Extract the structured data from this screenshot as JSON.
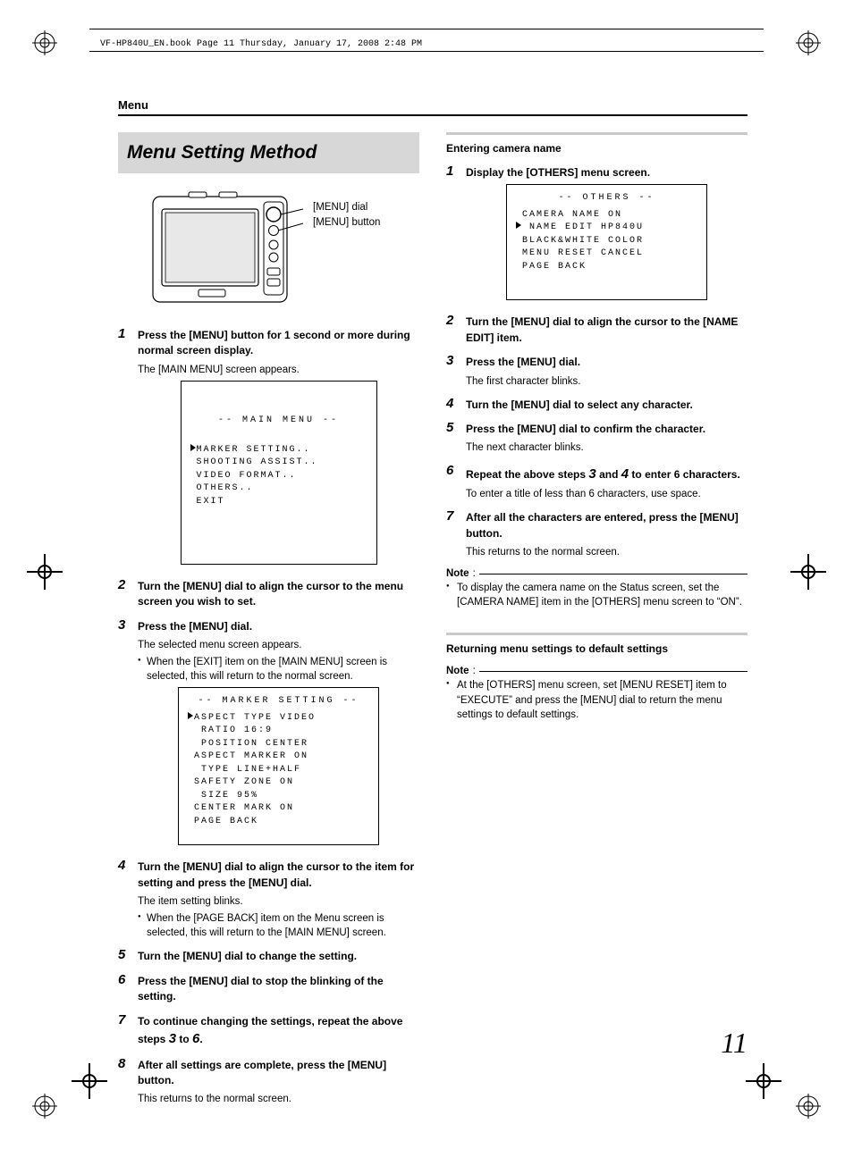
{
  "doc_header": "VF-HP840U_EN.book  Page 11  Thursday, January 17, 2008  2:48 PM",
  "section_label": "Menu",
  "title": "Menu Setting Method",
  "page_number": "11",
  "device": {
    "callout_dial": "[MENU] dial",
    "callout_button": "[MENU] button"
  },
  "left_steps": [
    {
      "head": "Press the [MENU] button for 1 second or more during normal screen display.",
      "body": "The [MAIN MENU] screen appears."
    },
    {
      "head": "Turn the [MENU] dial to align the cursor to the menu screen you wish to set.",
      "body": ""
    },
    {
      "head": "Press the [MENU] dial.",
      "body": "The selected menu screen appears.",
      "bullets": [
        "When the [EXIT] item on the [MAIN MENU] screen is selected, this will return to the normal screen."
      ]
    },
    {
      "head": "Turn the [MENU] dial to align the cursor to the item for setting and press the [MENU] dial.",
      "body": "The item setting blinks.",
      "bullets": [
        "When the [PAGE BACK] item on the Menu screen is selected, this will return to the [MAIN MENU] screen."
      ]
    },
    {
      "head": "Turn the [MENU] dial to change the setting.",
      "body": ""
    },
    {
      "head": "Press the [MENU] dial to stop the blinking of the setting.",
      "body": ""
    },
    {
      "head_pre": "To continue changing the settings, repeat the above steps ",
      "head_n1": "3",
      "head_mid": " to ",
      "head_n2": "6",
      "head_post": ".",
      "body": ""
    },
    {
      "head": "After all settings are complete, press the [MENU] button.",
      "body": "This returns to the normal screen."
    }
  ],
  "osd_main": {
    "title": "-- MAIN MENU --",
    "rows": [
      "MARKER SETTING..",
      "SHOOTING ASSIST..",
      "VIDEO FORMAT..",
      "OTHERS..",
      "EXIT"
    ]
  },
  "osd_marker": {
    "title": "-- MARKER SETTING --",
    "rows": [
      [
        "ASPECT TYPE",
        "VIDEO"
      ],
      [
        " RATIO",
        "16:9"
      ],
      [
        " POSITION",
        "CENTER"
      ],
      [
        "ASPECT MARKER",
        "ON"
      ],
      [
        " TYPE",
        "LINE+HALF"
      ],
      [
        "SAFETY ZONE",
        "ON"
      ],
      [
        " SIZE",
        "95%"
      ],
      [
        "CENTER MARK",
        "ON"
      ],
      [
        "PAGE BACK",
        ""
      ]
    ]
  },
  "right": {
    "header1": "Entering camera name",
    "steps": [
      {
        "head": "Display the [OTHERS] menu screen."
      },
      {
        "head": "Turn the [MENU] dial to align the cursor to the [NAME EDIT] item."
      },
      {
        "head": "Press the [MENU] dial.",
        "body": "The first character blinks."
      },
      {
        "head": "Turn the [MENU] dial to select any character."
      },
      {
        "head": "Press the [MENU] dial to confirm the character.",
        "body": "The next character blinks."
      },
      {
        "head_pre": "Repeat the above steps ",
        "head_n1": "3",
        "head_mid": " and ",
        "head_n2": "4",
        "head_post": " to enter 6 characters.",
        "body": "To enter a title of less than 6 characters, use space."
      },
      {
        "head": "After all the characters are entered, press the [MENU] button.",
        "body": "This returns to the normal screen."
      }
    ],
    "note1_label": "Note",
    "note1_body": "To display the camera name on the Status screen, set the [CAMERA NAME] item in the [OTHERS] menu screen to “ON”.",
    "header2": "Returning menu settings to default settings",
    "note2_label": "Note",
    "note2_body": "At the [OTHERS] menu screen, set [MENU RESET] item to “EXECUTE” and press the [MENU] dial to return the menu settings to default settings."
  },
  "osd_others": {
    "title": "-- OTHERS --",
    "rows": [
      [
        "CAMERA NAME",
        "ON"
      ],
      [
        " NAME EDIT",
        "HP840U"
      ],
      [
        "BLACK&WHITE",
        "COLOR"
      ],
      [
        "MENU RESET",
        "CANCEL"
      ],
      [
        "PAGE BACK",
        ""
      ]
    ]
  }
}
